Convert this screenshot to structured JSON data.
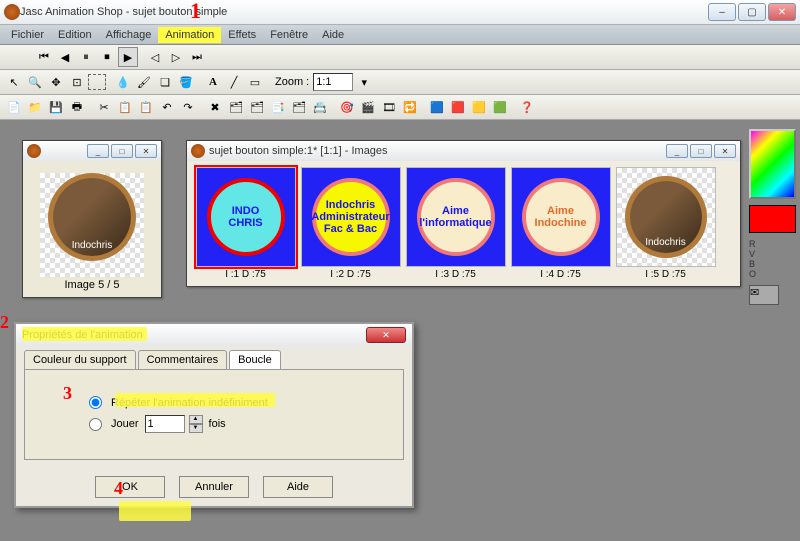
{
  "window": {
    "title": "Jasc Animation Shop - sujet bouton simple",
    "minimize": "–",
    "maximize": "▢",
    "close": "✕"
  },
  "menu": {
    "items": [
      {
        "label": "Fichier",
        "hl": false
      },
      {
        "label": "Edition",
        "hl": false
      },
      {
        "label": "Affichage",
        "hl": false
      },
      {
        "label": "Animation",
        "hl": true
      },
      {
        "label": "Effets",
        "hl": false
      },
      {
        "label": "Fenêtre",
        "hl": false
      },
      {
        "label": "Aide",
        "hl": false
      }
    ]
  },
  "toolbars": {
    "zoom_label": "Zoom :",
    "zoom_value": "1:1"
  },
  "preview": {
    "title": "",
    "label": "Image 5 / 5",
    "avatar_text": "Indochris"
  },
  "filmstrip": {
    "title": "sujet bouton simple:1* [1:1] - Images",
    "frames": [
      {
        "id": "I :1  D :75",
        "t1": "INDO",
        "t2": "CHRIS",
        "bg": "#63e6e6",
        "border": "#f00000",
        "fg": "#1414f4",
        "fs": "15px"
      },
      {
        "id": "I :2  D :75",
        "t1": "Indochris",
        "t2": "Administrateur",
        "t3": "Fac & Bac",
        "bg": "#f7f700",
        "border": "#f07878",
        "fg": "#1414f4",
        "fs": "12px"
      },
      {
        "id": "I :3  D :75",
        "t1": "Aime",
        "t2": "l'informatique",
        "bg": "#f8eccb",
        "border": "#f07878",
        "fg": "#1414f4",
        "fs": "12px"
      },
      {
        "id": "I :4  D :75",
        "t1": "Aime",
        "t2": "Indochine",
        "bg": "#f8eccb",
        "border": "#f07878",
        "fg": "#e56a2a",
        "fs": "12px"
      },
      {
        "id": "I :5  D :75",
        "avatar": "Indochris"
      }
    ]
  },
  "dialog": {
    "title": "Propriétés de l'animation",
    "tabs": {
      "a": "Couleur du support",
      "b": "Commentaires",
      "c": "Boucle"
    },
    "radio_repeat": "Répéter l'animation indéfiniment",
    "radio_play": "Jouer",
    "play_count": "1",
    "play_suffix": "fois",
    "ok": "OK",
    "cancel": "Annuler",
    "help": "Aide"
  },
  "annotations": {
    "a1": "1",
    "a2": "2",
    "a3": "3",
    "a4": "4"
  },
  "sidebar": {
    "labels": "R\nV\nB\nO"
  }
}
